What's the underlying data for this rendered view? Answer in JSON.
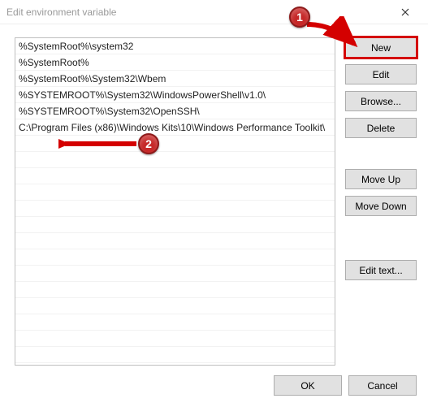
{
  "window": {
    "title": "Edit environment variable"
  },
  "list": {
    "rows": [
      "%SystemRoot%\\system32",
      "%SystemRoot%",
      "%SystemRoot%\\System32\\Wbem",
      "%SYSTEMROOT%\\System32\\WindowsPowerShell\\v1.0\\",
      "%SYSTEMROOT%\\System32\\OpenSSH\\",
      "C:\\Program Files (x86)\\Windows Kits\\10\\Windows Performance Toolkit\\"
    ]
  },
  "buttons": {
    "new": "New",
    "edit": "Edit",
    "browse": "Browse...",
    "delete": "Delete",
    "move_up": "Move Up",
    "move_down": "Move Down",
    "edit_text": "Edit text...",
    "ok": "OK",
    "cancel": "Cancel"
  },
  "annotations": {
    "one": "1",
    "two": "2"
  },
  "colors": {
    "highlight": "#d40000",
    "callout": "#c62828"
  }
}
